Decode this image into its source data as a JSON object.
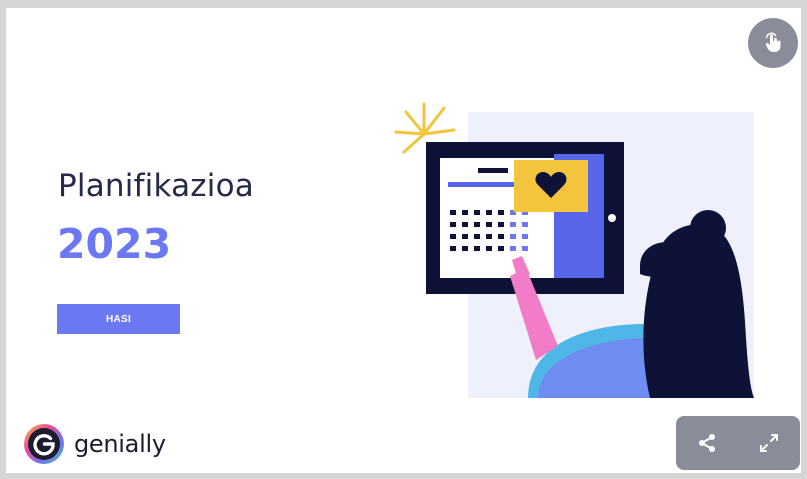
{
  "slide": {
    "title": "Planifikazioa",
    "year": "2023",
    "start_button": "HASI"
  },
  "brand": {
    "name": "genially"
  },
  "controls": {
    "interact_icon": "hand-pointer-icon",
    "share_icon": "share-icon",
    "fullscreen_icon": "expand-arrows-icon"
  },
  "colors": {
    "accent": "#6b78f2",
    "title": "#26294a",
    "control_bg": "#8a8d99"
  }
}
